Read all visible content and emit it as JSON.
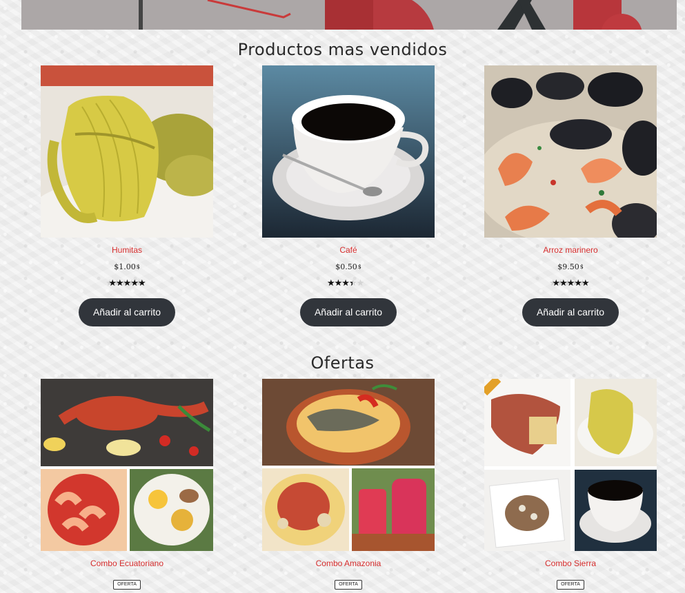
{
  "sections": {
    "best_sellers": {
      "title": "Productos mas vendidos"
    },
    "offers": {
      "title": "Ofertas"
    }
  },
  "best_sellers": [
    {
      "name": "Humitas",
      "price": "$1.00",
      "currency": "$",
      "rating": 5,
      "button": "Añadir al carrito"
    },
    {
      "name": "Café",
      "price": "$0.50",
      "currency": "$",
      "rating": 3,
      "button": "Añadir al carrito"
    },
    {
      "name": "Arroz marinero",
      "price": "$9.50",
      "currency": "$",
      "rating": 5,
      "button": "Añadir al carrito"
    }
  ],
  "offers": [
    {
      "name": "Combo Ecuatoriano",
      "badge": "OFERTA"
    },
    {
      "name": "Combo Amazonia",
      "badge": "OFERTA"
    },
    {
      "name": "Combo Sierra",
      "badge": "OFERTA"
    }
  ],
  "rating_max": 5,
  "colors": {
    "accent_red": "#d62d2d",
    "button_bg": "#31353b",
    "title_text": "#2a2a2a"
  },
  "icons": {
    "star": "star-icon"
  }
}
